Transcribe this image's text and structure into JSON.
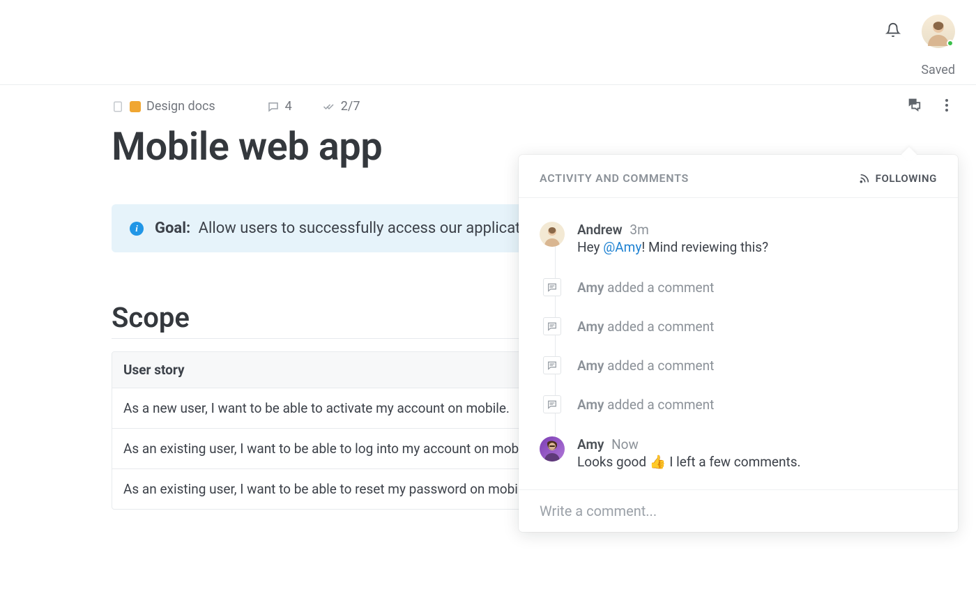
{
  "header": {
    "saved_label": "Saved",
    "has_notifications": false,
    "user_online": true
  },
  "doc": {
    "breadcrumb_label": "Design docs",
    "comment_count": "4",
    "checklist": "2/7",
    "title": "Mobile web app",
    "goal_label": "Goal:",
    "goal_text": " Allow users to successfully access our applicatio",
    "scope_heading": "Scope",
    "scope_header": "User story",
    "scope_rows": [
      "As a new user, I want to be able to activate my account on mobile.",
      "As an existing user, I want to be able to log into my account on mobi",
      "As an existing user, I want to be able to reset my password on mobil"
    ]
  },
  "activity": {
    "panel_title": "ACTIVITY AND COMMENTS",
    "following_label": "FOLLOWING",
    "items": [
      {
        "type": "comment",
        "author": "Andrew",
        "time": "3m",
        "message_pre": "Hey ",
        "mention": "@Amy",
        "message_post": "! Mind reviewing this?"
      },
      {
        "type": "event",
        "author": "Amy",
        "action": "added a comment"
      },
      {
        "type": "event",
        "author": "Amy",
        "action": "added a comment"
      },
      {
        "type": "event",
        "author": "Amy",
        "action": "added a comment"
      },
      {
        "type": "event",
        "author": "Amy",
        "action": "added a comment"
      },
      {
        "type": "comment",
        "author": "Amy",
        "time": "Now",
        "message": "Looks good 👍 I left a few comments."
      }
    ],
    "input_placeholder": "Write a comment..."
  }
}
